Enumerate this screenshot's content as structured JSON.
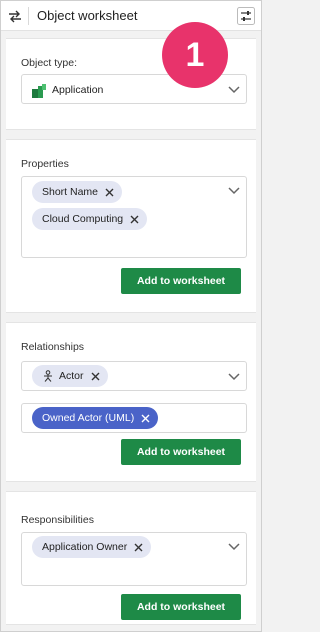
{
  "header": {
    "title": "Object worksheet"
  },
  "callout": {
    "number": "1"
  },
  "object_type": {
    "label": "Object type:",
    "selected": "Application"
  },
  "properties": {
    "label": "Properties",
    "chips": [
      "Short Name",
      "Cloud Computing"
    ],
    "button": "Add to worksheet"
  },
  "relationships": {
    "label": "Relationships",
    "chip": "Actor",
    "selected_chip": "Owned Actor (UML)",
    "button": "Add to worksheet"
  },
  "responsibilities": {
    "label": "Responsibilities",
    "chip": "Application Owner",
    "button": "Add to worksheet"
  },
  "colors": {
    "accent_green": "#1e8a47",
    "chip_bg": "#e3e6f3",
    "chip_selected": "#4a63c8",
    "callout": "#e8336b"
  }
}
